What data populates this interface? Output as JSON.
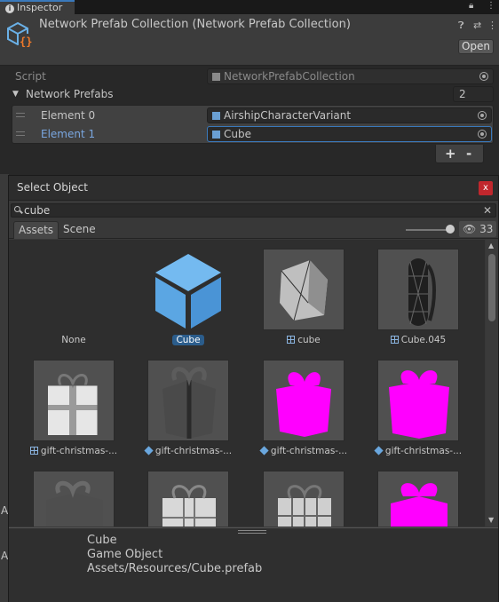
{
  "tab": {
    "title": "Inspector"
  },
  "header": {
    "title": "Network Prefab Collection (Network Prefab Collection)",
    "open_label": "Open"
  },
  "script_row": {
    "label": "Script",
    "value": "NetworkPrefabCollection"
  },
  "prefabs": {
    "label": "Network Prefabs",
    "count": "2"
  },
  "elements": [
    {
      "label": "Element 0",
      "value": "AirshipCharacterVariant"
    },
    {
      "label": "Element 1",
      "value": "Cube"
    }
  ],
  "list_buttons": {
    "add": "+",
    "remove": "-"
  },
  "picker": {
    "title": "Select Object",
    "close": "x",
    "search": "cube",
    "tabs": [
      "Assets",
      "Scene"
    ],
    "hidden_count": "33",
    "items": [
      {
        "label": "None",
        "icon": "none"
      },
      {
        "label": "Cube",
        "icon": "prefab",
        "selected": true
      },
      {
        "label": "cube",
        "icon": "mesh"
      },
      {
        "label": "Cube.045",
        "icon": "mesh"
      },
      {
        "label": "gift-christmas-...",
        "icon": "mesh"
      },
      {
        "label": "gift-christmas-...",
        "icon": "prefab"
      },
      {
        "label": "gift-christmas-...",
        "icon": "prefab"
      },
      {
        "label": "gift-christmas-...",
        "icon": "prefab"
      },
      {
        "label": "",
        "icon": "none"
      },
      {
        "label": "",
        "icon": "none"
      },
      {
        "label": "",
        "icon": "none"
      },
      {
        "label": "",
        "icon": "none"
      }
    ],
    "preview": {
      "name": "Cube",
      "type": "Game Object",
      "path": "Assets/Resources/Cube.prefab"
    }
  }
}
